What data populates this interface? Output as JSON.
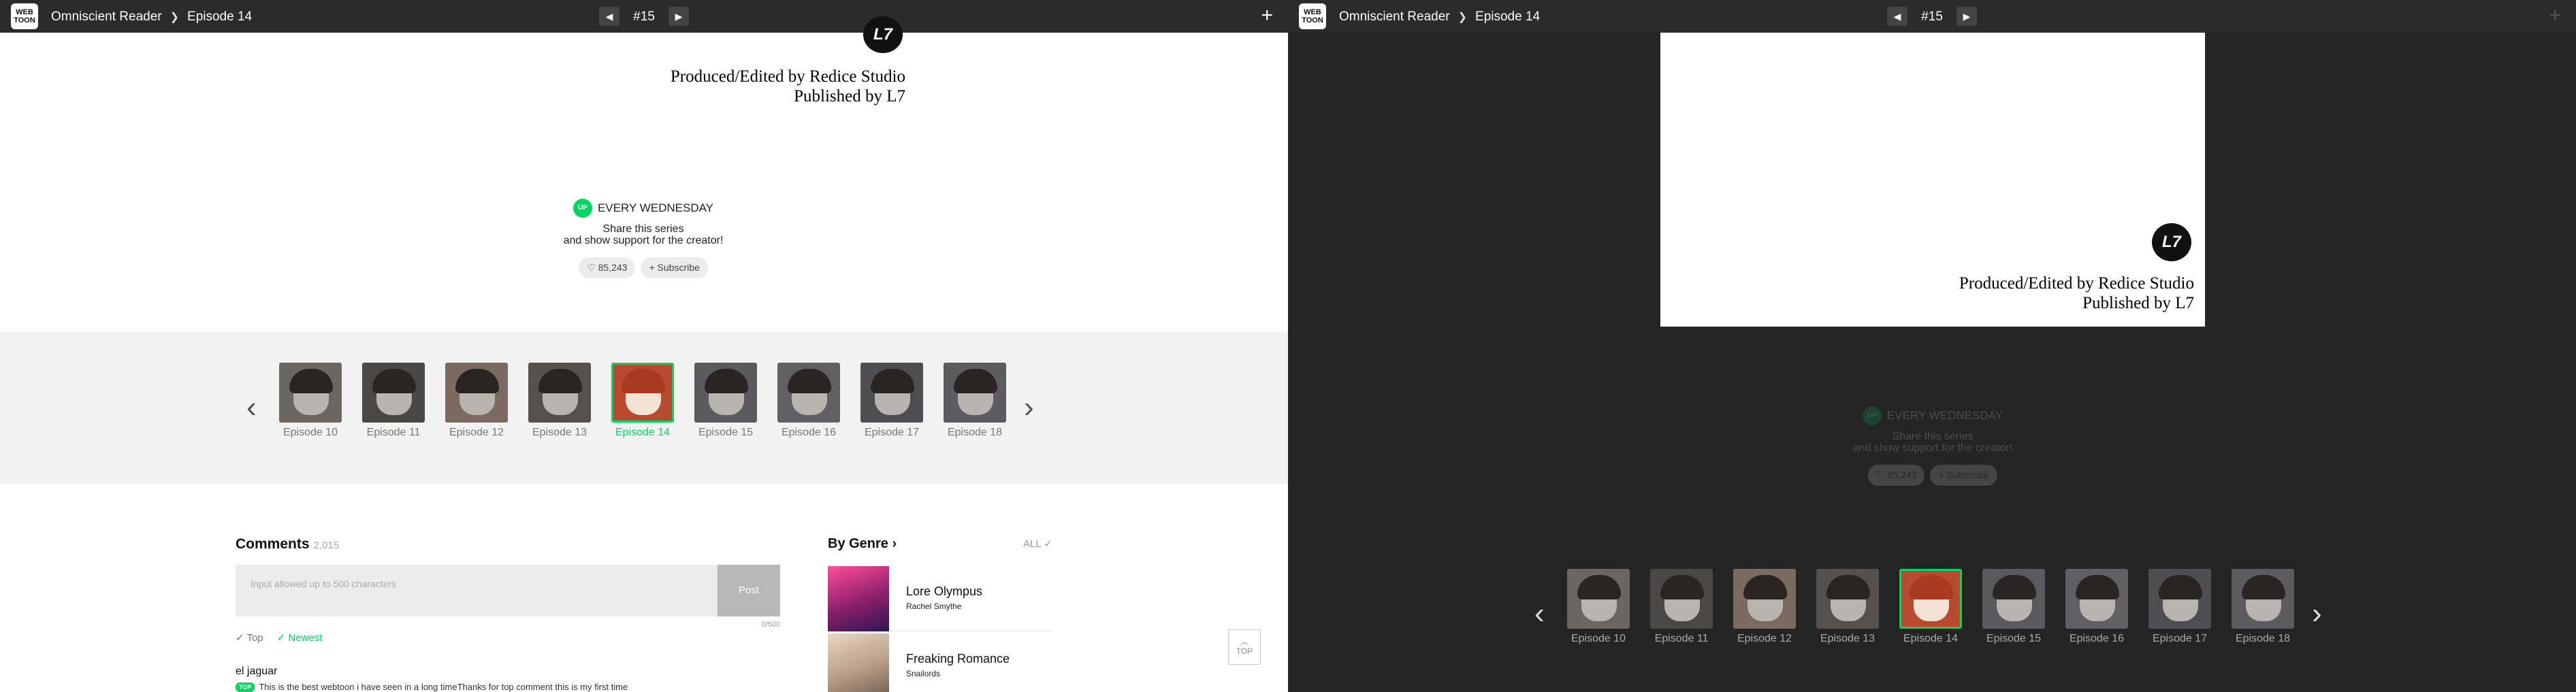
{
  "left": {
    "breadcrumb": {
      "series": "Omniscient Reader",
      "episode": "Episode 14"
    },
    "episode_number": "#15",
    "credits": {
      "line1": "Produced/Edited by Redice Studio",
      "line2": "Published by L7"
    },
    "logo_text": "WEB TOON",
    "l7_text": "L7",
    "schedule": {
      "badge": "UP",
      "text": "EVERY WEDNESDAY",
      "share_line1": "Share this series",
      "share_line2": "and show support for the creator!"
    },
    "like_count": "85,243",
    "subscribe_label": "Subscribe",
    "episodes": [
      "Episode 10",
      "Episode 11",
      "Episode 12",
      "Episode 13",
      "Episode 14",
      "Episode 15",
      "Episode 16",
      "Episode 17",
      "Episode 18"
    ],
    "current_episode_index": 4,
    "comments": {
      "title": "Comments",
      "count": "2,015",
      "placeholder": "Input allowed up to 500 characters",
      "post_label": "Post",
      "char_count": "0/500",
      "sort_top": "Top",
      "sort_newest": "Newest",
      "first_user": "el jaguar",
      "first_badge": "TOP",
      "first_text": "This is the best webtoon i have seen in a long timeThanks for top comment this is my first time"
    },
    "genre": {
      "title": "By Genre",
      "all_label": "ALL",
      "items": [
        {
          "title": "Lore Olympus",
          "author": "Rachel Smythe"
        },
        {
          "title": "Freaking Romance",
          "author": "Snailords"
        }
      ]
    },
    "top_button": "TOP"
  },
  "right": {
    "breadcrumb": {
      "series": "Omniscient Reader",
      "episode": "Episode 14"
    },
    "episode_number": "#15",
    "credits": {
      "line1": "Produced/Edited by Redice Studio",
      "line2": "Published by L7"
    },
    "logo_text": "WEB TOON",
    "l7_text": "L7",
    "schedule": {
      "badge": "UP",
      "text": "EVERY WEDNESDAY",
      "share_line1": "Share this series",
      "share_line2": "and show support for the creator!"
    },
    "like_count": "85,243",
    "subscribe_label": "Subscribe",
    "episodes": [
      "Episode 10",
      "Episode 11",
      "Episode 12",
      "Episode 13",
      "Episode 14",
      "Episode 15",
      "Episode 16",
      "Episode 17",
      "Episode 18"
    ]
  },
  "icons": {
    "prev": "triangle-left-icon",
    "next": "triangle-right-icon",
    "plus": "plus-icon",
    "heart": "heart-icon",
    "chevron": "chevron-icon",
    "check": "check-icon"
  },
  "colors": {
    "accent": "#00d564",
    "topbar": "#2b2b2b",
    "dark_bg": "#242424",
    "strip_bg": "#f2f2f2"
  }
}
